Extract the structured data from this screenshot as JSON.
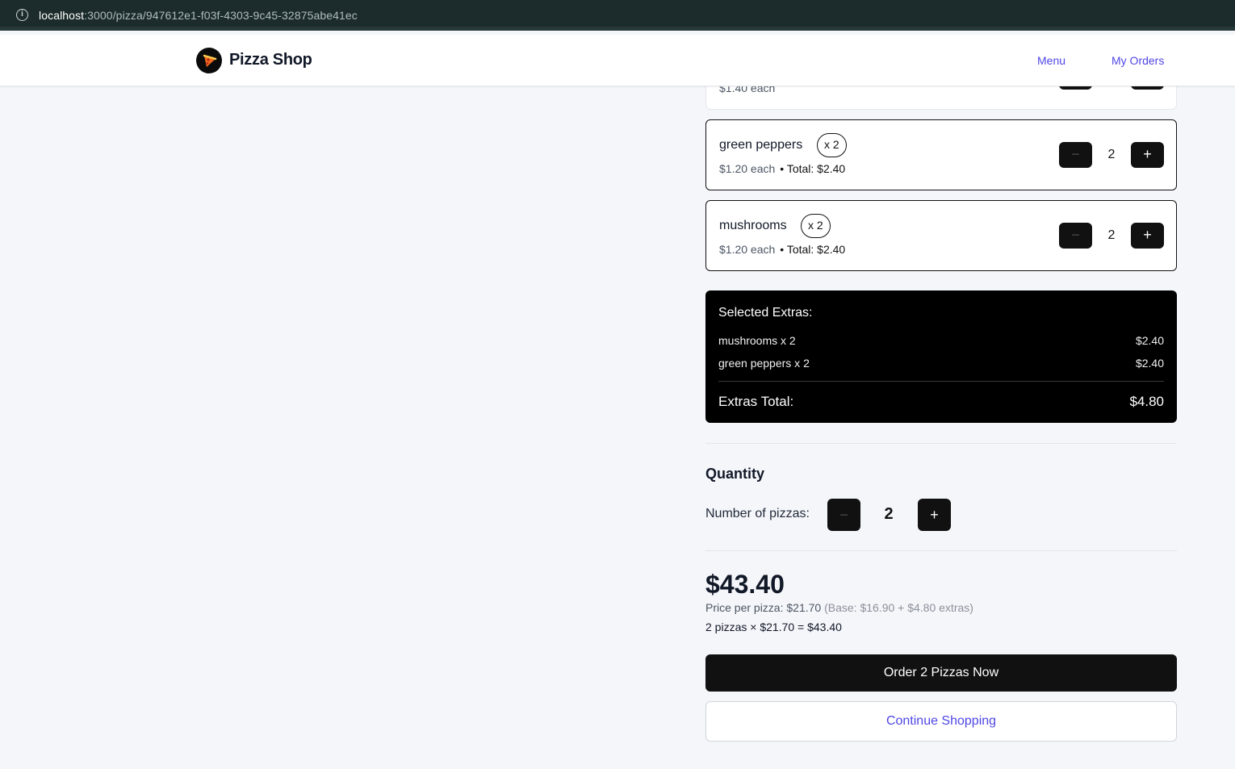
{
  "browser": {
    "url_host": "localhost",
    "url_path": ":3000/pizza/947612e1-f03f-4303-9c45-32875abe41ec"
  },
  "header": {
    "brand": "Pizza Shop",
    "nav": {
      "menu": "Menu",
      "orders": "My Orders"
    }
  },
  "extras_list": {
    "partial": {
      "price": "$1.40 each"
    },
    "items": [
      {
        "name": "green peppers",
        "badge": "x 2",
        "price": "$1.20 each",
        "total": "• Total: $2.40",
        "count": "2",
        "minus": "−",
        "plus": "+"
      },
      {
        "name": "mushrooms",
        "badge": "x 2",
        "price": "$1.20 each",
        "total": "• Total: $2.40",
        "count": "2",
        "minus": "−",
        "plus": "+"
      }
    ]
  },
  "summary": {
    "title": "Selected Extras:",
    "rows": [
      {
        "label": "mushrooms x 2",
        "amount": "$2.40"
      },
      {
        "label": "green peppers x 2",
        "amount": "$2.40"
      }
    ],
    "total_label": "Extras Total:",
    "total_amount": "$4.80"
  },
  "quantity": {
    "title": "Quantity",
    "label": "Number of pizzas:",
    "value": "2",
    "minus": "−",
    "plus": "+"
  },
  "pricing": {
    "total": "$43.40",
    "per_pizza": "Price per pizza: $21.70",
    "base_note": "(Base: $16.90 + $4.80 extras)",
    "calc": "2 pizzas × $21.70 = $43.40"
  },
  "actions": {
    "order": "Order 2 Pizzas Now",
    "continue": "Continue Shopping"
  },
  "colors": {
    "accent": "#4f46e5",
    "dark": "#111111",
    "background": "#f5f6fa"
  }
}
